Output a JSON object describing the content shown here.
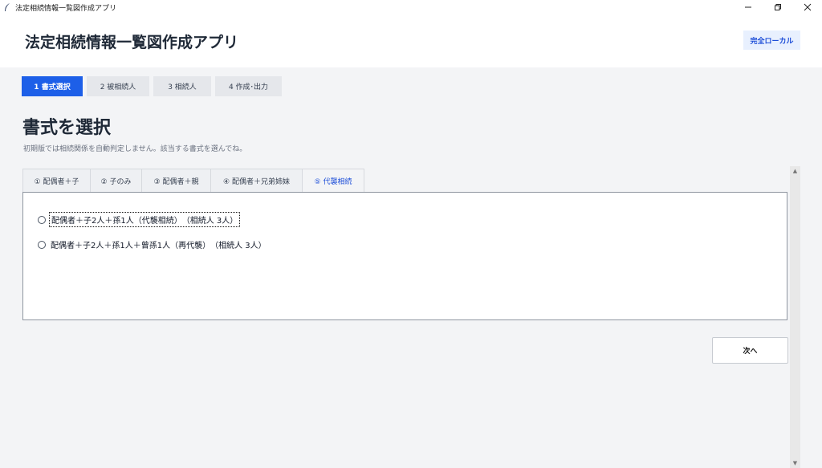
{
  "window": {
    "title": "法定相続情報一覧図作成アプリ",
    "controls": [
      "minimize-icon",
      "restore-icon",
      "close-icon"
    ]
  },
  "header": {
    "app_title": "法定相続情報一覧図作成アプリ",
    "badge": "完全ローカル"
  },
  "steps": [
    {
      "label": "1  書式選択",
      "active": true
    },
    {
      "label": "2  被相続人",
      "active": false
    },
    {
      "label": "3  相続人",
      "active": false
    },
    {
      "label": "4  作成･出力",
      "active": false
    }
  ],
  "page": {
    "title": "書式を選択",
    "subtitle": "初期版では相続関係を自動判定しません。該当する書式を選んでね。"
  },
  "tabs": [
    {
      "label": "① 配偶者＋子",
      "active": false
    },
    {
      "label": "② 子のみ",
      "active": false
    },
    {
      "label": "③ 配偶者＋親",
      "active": false
    },
    {
      "label": "④ 配偶者＋兄弟姉妹",
      "active": false
    },
    {
      "label": "⑤ 代襲相続",
      "active": true
    }
  ],
  "options": [
    {
      "label": "配偶者＋子2人＋孫1人（代襲相続）　（相続人 3人）",
      "selected": false,
      "focused": true
    },
    {
      "label": "配偶者＋子2人＋孫1人＋曾孫1人（再代襲）　（相続人 3人）",
      "selected": false,
      "focused": false
    }
  ],
  "actions": {
    "next": "次へ"
  },
  "colors": {
    "accent": "#1d5fe8",
    "background": "#f3f4f6",
    "badge_bg": "#e8f0fe"
  }
}
